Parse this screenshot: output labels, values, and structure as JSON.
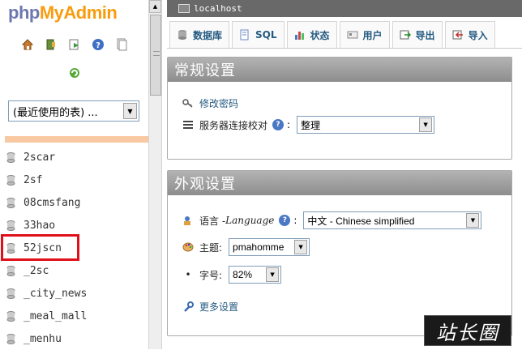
{
  "logo": {
    "part1": "php",
    "part2": "MyAdmin"
  },
  "nav_icons": [
    "home-icon",
    "exit-icon",
    "query-window-icon",
    "help-icon",
    "docs-icon",
    "reload-icon"
  ],
  "db_select": {
    "value": "(最近使用的表) ..."
  },
  "databases": [
    "2scar",
    "2sf",
    "08cmsfang",
    "33hao",
    "52jscn",
    "_2sc",
    "_city_news",
    "_meal_mall",
    "_menhu"
  ],
  "highlighted_db": "52jscn",
  "server": {
    "label": "localhost"
  },
  "tabs": [
    {
      "label": "数据库",
      "icon": "database-icon"
    },
    {
      "label": "SQL",
      "icon": "sql-icon"
    },
    {
      "label": "状态",
      "icon": "status-icon"
    },
    {
      "label": "用户",
      "icon": "users-icon"
    },
    {
      "label": "导出",
      "icon": "export-icon"
    },
    {
      "label": "导入",
      "icon": "import-icon"
    }
  ],
  "general": {
    "title": "常规设置",
    "change_password": "修改密码",
    "collation_label": "服务器连接校对",
    "collation_value": "整理",
    "colon": ":"
  },
  "appearance": {
    "title": "外观设置",
    "language_label": "语言 - ",
    "language_en": "Language",
    "language_value": "中文 - Chinese simplified",
    "theme_label": "主题:",
    "theme_value": "pmahomme",
    "fontsize_label": "字号:",
    "fontsize_value": "82%",
    "more_settings": "更多设置",
    "colon": ":",
    "bullet": "•"
  },
  "help_glyph": "?",
  "watermark": "站长圈",
  "colors": {
    "server_bar": "#696969",
    "panel_header": "#9a9a9a",
    "link": "#235a81",
    "logo_php": "#6c78af",
    "logo_admin": "#f89c0e",
    "highlight": "#e0101a"
  }
}
